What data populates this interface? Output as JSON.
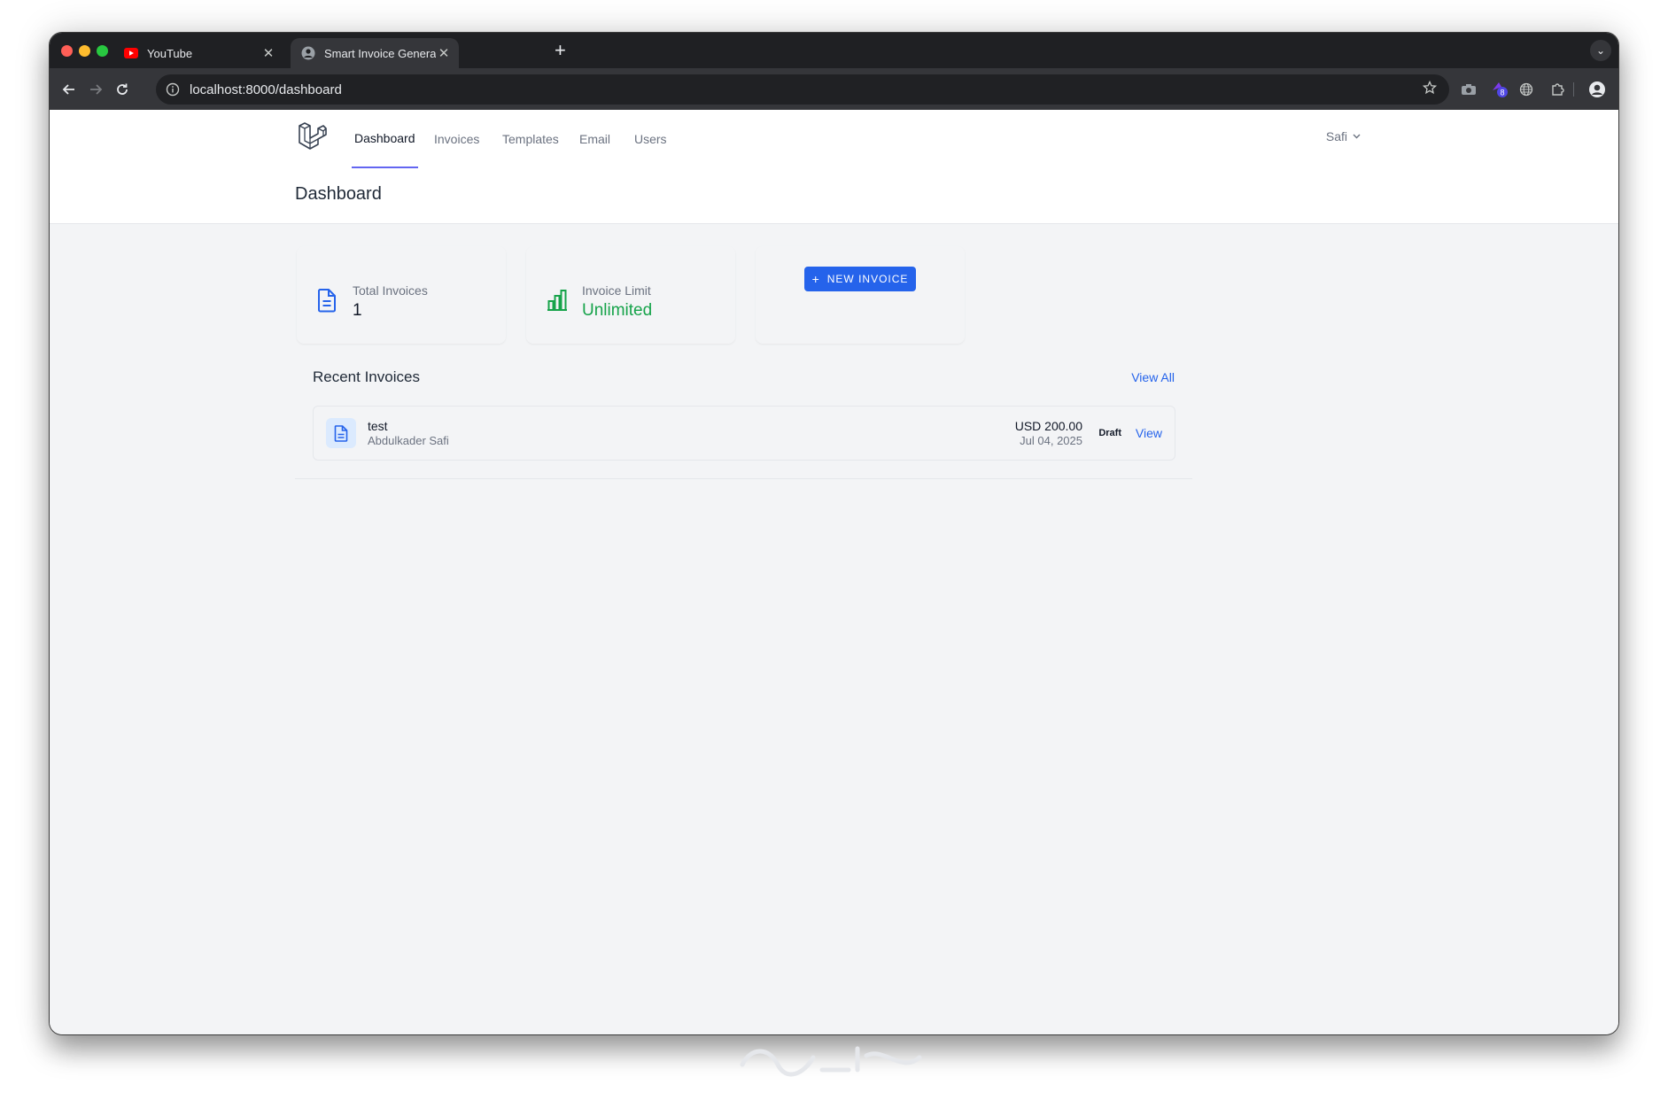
{
  "browser": {
    "tabs": [
      {
        "title": "YouTube",
        "icon": "youtube-icon",
        "active": false
      },
      {
        "title": "Smart Invoice Generator",
        "icon": "profile-icon",
        "active": true
      }
    ],
    "url": "localhost:8000/dashboard",
    "extension_badge": "8"
  },
  "app": {
    "nav": [
      {
        "label": "Dashboard",
        "active": true
      },
      {
        "label": "Invoices",
        "active": false
      },
      {
        "label": "Templates",
        "active": false
      },
      {
        "label": "Email",
        "active": false
      },
      {
        "label": "Users",
        "active": false
      }
    ],
    "user": "Safi",
    "page_title": "Dashboard"
  },
  "stats": {
    "total_invoices": {
      "label": "Total Invoices",
      "value": "1"
    },
    "invoice_limit": {
      "label": "Invoice Limit",
      "value": "Unlimited"
    }
  },
  "actions": {
    "new_invoice": "NEW INVOICE"
  },
  "recent": {
    "title": "Recent Invoices",
    "view_all": "View All",
    "items": [
      {
        "name": "test",
        "client": "Abdulkader Safi",
        "amount": "USD 200.00",
        "date": "Jul 04, 2025",
        "status": "Draft",
        "action": "View"
      }
    ]
  },
  "colors": {
    "primary": "#2563eb",
    "success": "#16a34a",
    "nav_indicator": "#6366f1",
    "page_bg": "#f3f4f6",
    "chrome_dark": "#1f2023",
    "toolbar": "#35363a"
  }
}
